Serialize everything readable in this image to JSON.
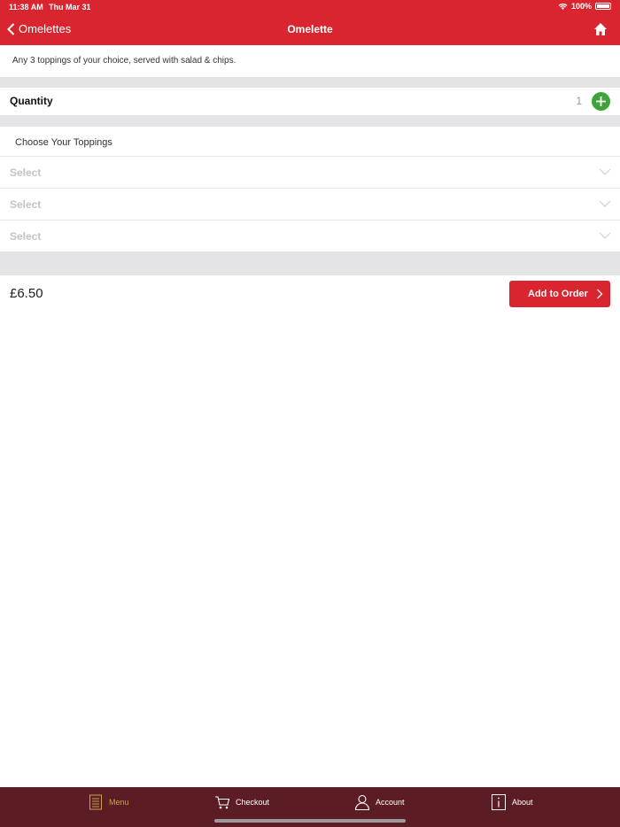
{
  "status": {
    "time": "11:38 AM",
    "date": "Thu Mar 31",
    "battery": "100%"
  },
  "nav": {
    "back_label": "Omelettes",
    "title": "Omelette"
  },
  "item": {
    "description": "Any 3 toppings of your choice, served with salad & chips.",
    "quantity_label": "Quantity",
    "quantity_value": "1",
    "toppings_heading": "Choose Your Toppings",
    "selects": [
      {
        "label": "Select"
      },
      {
        "label": "Select"
      },
      {
        "label": "Select"
      }
    ],
    "price": "£6.50",
    "add_label": "Add to Order"
  },
  "tabs": [
    {
      "label": "Menu",
      "icon": "menu-icon",
      "active": true
    },
    {
      "label": "Checkout",
      "icon": "cart-icon"
    },
    {
      "label": "Account",
      "icon": "person-icon"
    },
    {
      "label": "About",
      "icon": "info-icon"
    }
  ],
  "colors": {
    "brand_red": "#d9252f",
    "tabbar": "#5c1c24",
    "active_tab": "#c9a34a",
    "plus_green": "#3ea43a"
  }
}
